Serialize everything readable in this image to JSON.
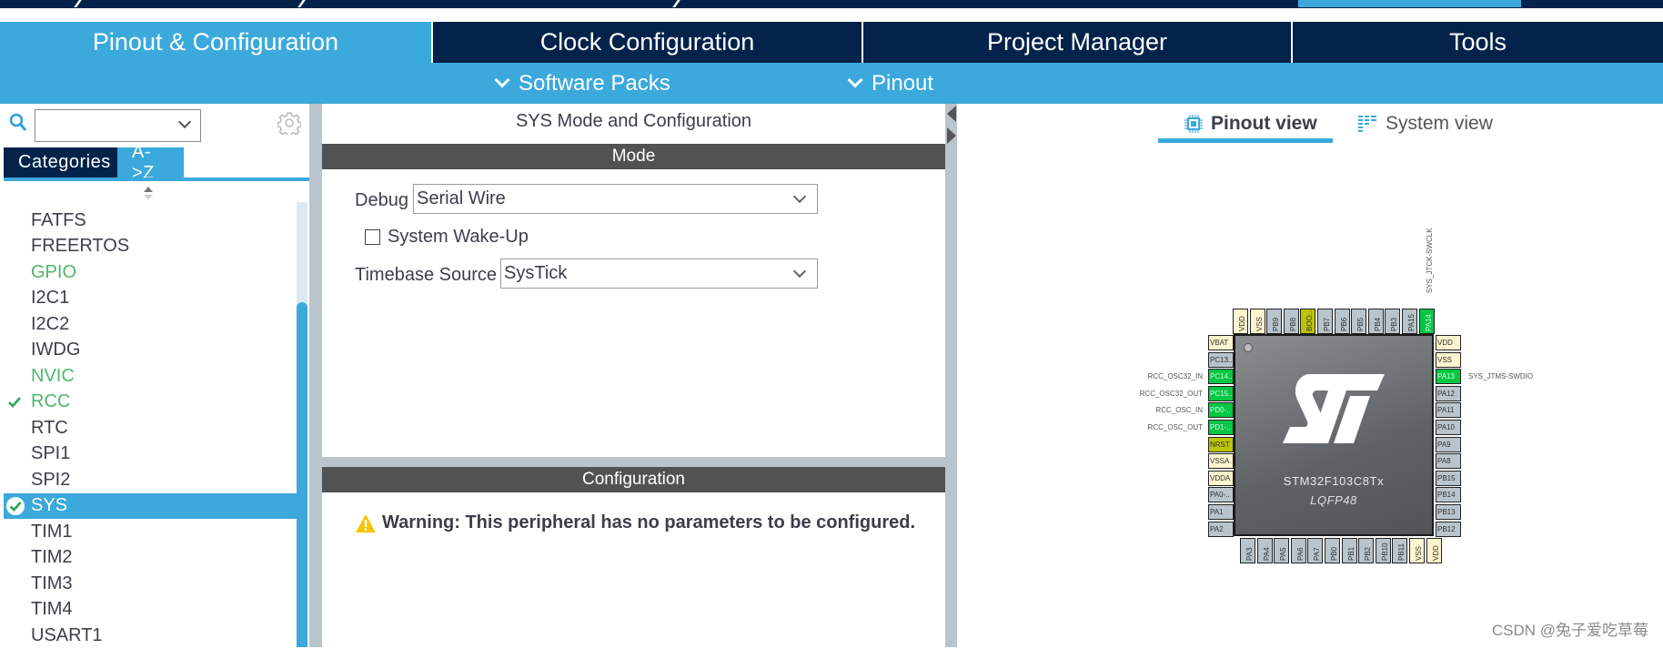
{
  "main_tabs": [
    {
      "label": "Pinout & Configuration",
      "active": true
    },
    {
      "label": "Clock Configuration",
      "active": false
    },
    {
      "label": "Project Manager",
      "active": false
    },
    {
      "label": "Tools",
      "active": false
    }
  ],
  "sub_tabs": [
    {
      "label": "Software Packs"
    },
    {
      "label": "Pinout"
    }
  ],
  "left_panel": {
    "search": {
      "value": "",
      "placeholder": ""
    },
    "category_tabs": [
      {
        "label": "Categories",
        "active": false
      },
      {
        "label": "A->Z",
        "active": true
      }
    ],
    "items": [
      {
        "label": "FATFS",
        "state": "normal"
      },
      {
        "label": "FREERTOS",
        "state": "normal"
      },
      {
        "label": "GPIO",
        "state": "configured"
      },
      {
        "label": "I2C1",
        "state": "normal"
      },
      {
        "label": "I2C2",
        "state": "normal"
      },
      {
        "label": "IWDG",
        "state": "normal"
      },
      {
        "label": "NVIC",
        "state": "configured"
      },
      {
        "label": "RCC",
        "state": "checked"
      },
      {
        "label": "RTC",
        "state": "normal"
      },
      {
        "label": "SPI1",
        "state": "normal"
      },
      {
        "label": "SPI2",
        "state": "normal"
      },
      {
        "label": "SYS",
        "state": "selected"
      },
      {
        "label": "TIM1",
        "state": "normal"
      },
      {
        "label": "TIM2",
        "state": "normal"
      },
      {
        "label": "TIM3",
        "state": "normal"
      },
      {
        "label": "TIM4",
        "state": "normal"
      },
      {
        "label": "USART1",
        "state": "normal"
      }
    ]
  },
  "mid_panel": {
    "title": "SYS Mode and Configuration",
    "mode_header": "Mode",
    "debug": {
      "label": "Debug",
      "value": "Serial Wire"
    },
    "wakeup": {
      "label": "System Wake-Up",
      "checked": false
    },
    "timebase": {
      "label": "Timebase Source",
      "value": "SysTick"
    },
    "config_header": "Configuration",
    "warning": "Warning: This peripheral has no parameters to be configured."
  },
  "right_panel": {
    "view_tabs": [
      {
        "label": "Pinout view",
        "active": true
      },
      {
        "label": "System view",
        "active": false
      }
    ],
    "chip": {
      "name": "STM32F103C8Tx",
      "package": "LQFP48",
      "top_pins": [
        {
          "name": "VDD",
          "type": "power"
        },
        {
          "name": "VSS",
          "type": "power"
        },
        {
          "name": "PB9",
          "type": "grey"
        },
        {
          "name": "PB8",
          "type": "grey"
        },
        {
          "name": "BOO..",
          "type": "olive"
        },
        {
          "name": "PB7",
          "type": "grey"
        },
        {
          "name": "PB6",
          "type": "grey"
        },
        {
          "name": "PB5",
          "type": "grey"
        },
        {
          "name": "PB4",
          "type": "grey"
        },
        {
          "name": "PB3",
          "type": "grey"
        },
        {
          "name": "PA15",
          "type": "grey"
        },
        {
          "name": "PA14",
          "type": "green"
        }
      ],
      "left_pins": [
        {
          "name": "VBAT",
          "type": "power",
          "signal": ""
        },
        {
          "name": "PC13..",
          "type": "grey",
          "signal": ""
        },
        {
          "name": "PC14..",
          "type": "green",
          "signal": "RCC_OSC32_IN"
        },
        {
          "name": "PC15..",
          "type": "green",
          "signal": "RCC_OSC32_OUT"
        },
        {
          "name": "PD0-..",
          "type": "green",
          "signal": "RCC_OSC_IN"
        },
        {
          "name": "PD1-..",
          "type": "green",
          "signal": "RCC_OSC_OUT"
        },
        {
          "name": "NRST",
          "type": "olive",
          "signal": ""
        },
        {
          "name": "VSSA",
          "type": "power",
          "signal": ""
        },
        {
          "name": "VDDA",
          "type": "power",
          "signal": ""
        },
        {
          "name": "PA0-..",
          "type": "grey",
          "signal": ""
        },
        {
          "name": "PA1",
          "type": "grey",
          "signal": ""
        },
        {
          "name": "PA2",
          "type": "grey",
          "signal": ""
        }
      ],
      "right_pins": [
        {
          "name": "VDD",
          "type": "power",
          "signal": ""
        },
        {
          "name": "VSS",
          "type": "power",
          "signal": ""
        },
        {
          "name": "PA13",
          "type": "green",
          "signal": "SYS_JTMS-SWDIO"
        },
        {
          "name": "PA12",
          "type": "grey",
          "signal": ""
        },
        {
          "name": "PA11",
          "type": "grey",
          "signal": ""
        },
        {
          "name": "PA10",
          "type": "grey",
          "signal": ""
        },
        {
          "name": "PA9",
          "type": "grey",
          "signal": ""
        },
        {
          "name": "PA8",
          "type": "grey",
          "signal": ""
        },
        {
          "name": "PB15",
          "type": "grey",
          "signal": ""
        },
        {
          "name": "PB14",
          "type": "grey",
          "signal": ""
        },
        {
          "name": "PB13",
          "type": "grey",
          "signal": ""
        },
        {
          "name": "PB12",
          "type": "grey",
          "signal": ""
        }
      ],
      "bottom_pins": [
        {
          "name": "PA3",
          "type": "grey"
        },
        {
          "name": "PA4",
          "type": "grey"
        },
        {
          "name": "PA5",
          "type": "grey"
        },
        {
          "name": "PA6",
          "type": "grey"
        },
        {
          "name": "PA7",
          "type": "grey"
        },
        {
          "name": "PB0",
          "type": "grey"
        },
        {
          "name": "PB1",
          "type": "grey"
        },
        {
          "name": "PB2",
          "type": "grey"
        },
        {
          "name": "PB10",
          "type": "grey"
        },
        {
          "name": "PB11",
          "type": "grey"
        },
        {
          "name": "VSS",
          "type": "power"
        },
        {
          "name": "VDD",
          "type": "power"
        }
      ],
      "top_signal": "SYS_JTCK-SWCLK"
    }
  },
  "watermark": "CSDN @兔子爱吃草莓"
}
